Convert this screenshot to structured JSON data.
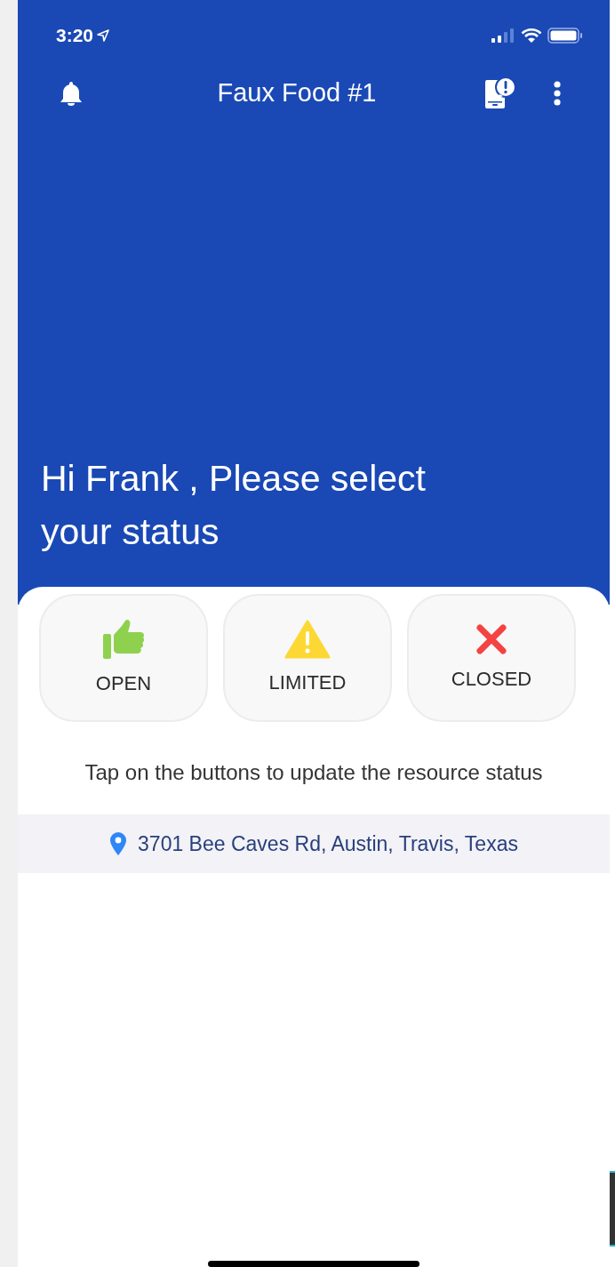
{
  "status_bar": {
    "time": "3:20"
  },
  "header": {
    "title": "Faux Food #1"
  },
  "greeting": "Hi Frank , Please select your status",
  "statuses": [
    {
      "kind": "open",
      "label": "OPEN"
    },
    {
      "kind": "limited",
      "label": "LIMITED"
    },
    {
      "kind": "closed",
      "label": "CLOSED"
    }
  ],
  "hint": "Tap on the buttons to update the resource status",
  "address": "3701 Bee Caves Rd, Austin, Travis, Texas"
}
